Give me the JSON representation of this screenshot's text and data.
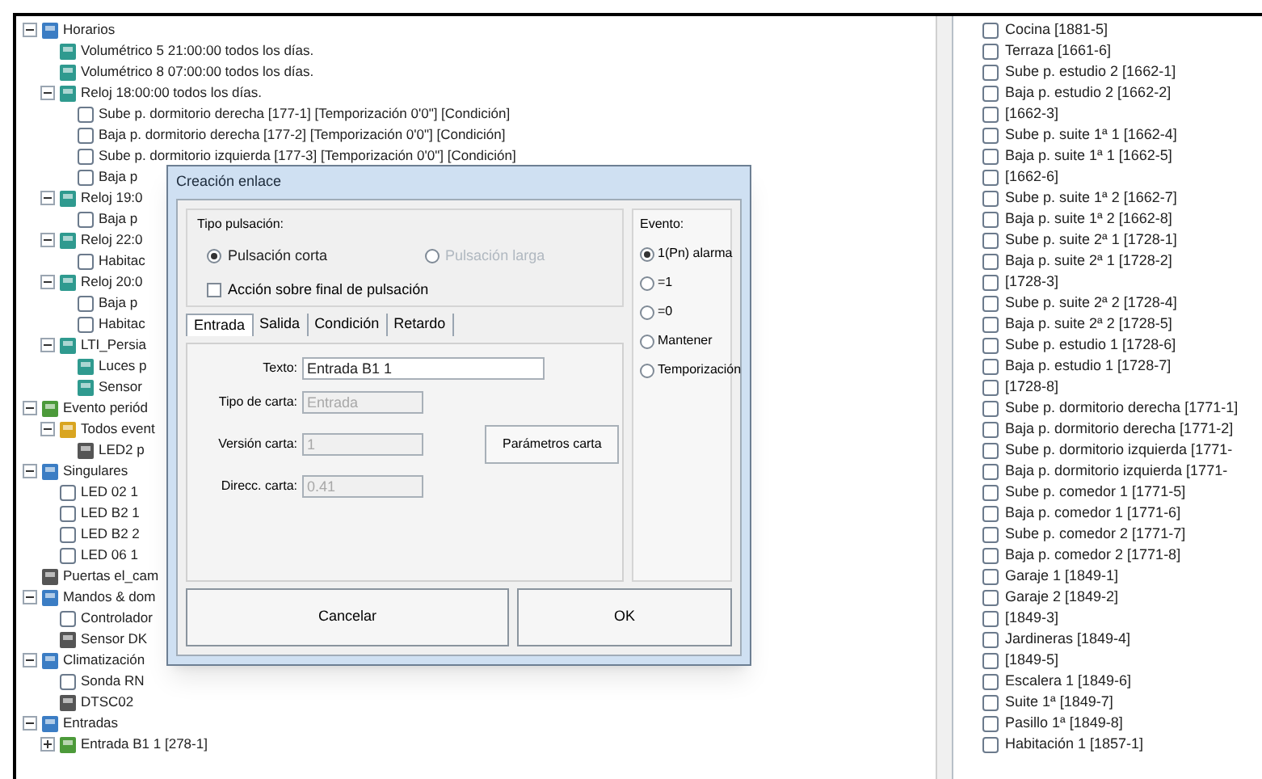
{
  "tree": [
    {
      "label": "Horarios",
      "kind": "group",
      "expanded": true,
      "children": [
        {
          "label": "Volumétrico 5 21:00:00 todos los días.",
          "kind": "schedule"
        },
        {
          "label": "Volumétrico 8 07:00:00 todos los días.",
          "kind": "schedule"
        },
        {
          "label": "Reloj 18:00:00 todos los días.",
          "kind": "schedule",
          "expanded": true,
          "children": [
            {
              "label": "Sube p. dormitorio derecha [177-1] [Temporización 0'0\"] [Condición]",
              "kind": "action"
            },
            {
              "label": "Baja p. dormitorio derecha [177-2] [Temporización 0'0\"] [Condición]",
              "kind": "action"
            },
            {
              "label": "Sube p. dormitorio izquierda [177-3] [Temporización 0'0\"] [Condición]",
              "kind": "action"
            },
            {
              "label": "Baja p",
              "kind": "action"
            }
          ]
        },
        {
          "label": "Reloj 19:0",
          "kind": "schedule",
          "expanded": true,
          "children": [
            {
              "label": "Baja p",
              "kind": "action"
            }
          ]
        },
        {
          "label": "Reloj 22:0",
          "kind": "schedule",
          "expanded": true,
          "children": [
            {
              "label": "Habitac",
              "kind": "action"
            }
          ]
        },
        {
          "label": "Reloj 20:0",
          "kind": "schedule",
          "expanded": true,
          "children": [
            {
              "label": "Baja p",
              "kind": "action"
            },
            {
              "label": "Habitac",
              "kind": "action"
            }
          ]
        },
        {
          "label": "LTI_Persia",
          "kind": "schedule",
          "expanded": true,
          "children": [
            {
              "label": "Luces p",
              "kind": "schedule"
            },
            {
              "label": "Sensor",
              "kind": "schedule"
            }
          ]
        }
      ]
    },
    {
      "label": "Evento periód",
      "kind": "event",
      "expanded": true,
      "children": [
        {
          "label": "Todos event",
          "kind": "alarm",
          "expanded": true,
          "children": [
            {
              "label": "LED2 p",
              "kind": "device"
            }
          ]
        }
      ]
    },
    {
      "label": "Singulares",
      "kind": "group",
      "expanded": true,
      "children": [
        {
          "label": "LED 02 1",
          "kind": "action"
        },
        {
          "label": "LED B2 1",
          "kind": "action"
        },
        {
          "label": "LED B2 2",
          "kind": "action"
        },
        {
          "label": "LED 06 1",
          "kind": "action"
        }
      ]
    },
    {
      "label": "Puertas el_cam",
      "kind": "device"
    },
    {
      "label": "Mandos & dom",
      "kind": "group",
      "expanded": true,
      "children": [
        {
          "label": "Controlador",
          "kind": "action"
        },
        {
          "label": "Sensor DK",
          "kind": "device"
        }
      ]
    },
    {
      "label": "Climatización",
      "kind": "group",
      "expanded": true,
      "children": [
        {
          "label": "Sonda RN",
          "kind": "action"
        },
        {
          "label": "DTSC02",
          "kind": "device"
        }
      ]
    },
    {
      "label": "Entradas",
      "kind": "group",
      "expanded": true,
      "children": [
        {
          "label": "Entrada B1 1 [278-1]",
          "kind": "event",
          "expanded": false
        }
      ]
    }
  ],
  "dialog": {
    "title": "Creación enlace",
    "press_group": {
      "title": "Tipo pulsación:",
      "options": [
        {
          "label": "Pulsación corta",
          "selected": true,
          "disabled": false
        },
        {
          "label": "Pulsación larga",
          "selected": false,
          "disabled": true
        }
      ],
      "end_action": {
        "label": "Acción sobre final de pulsación",
        "checked": false
      }
    },
    "tabs": [
      {
        "label": "Entrada",
        "selected": true
      },
      {
        "label": "Salida",
        "selected": false
      },
      {
        "label": "Condición",
        "selected": false
      },
      {
        "label": "Retardo",
        "selected": false
      }
    ],
    "fields": [
      {
        "label": "Texto:",
        "value": "Entrada B1 1",
        "disabled": false,
        "wide": true
      },
      {
        "label": "Tipo de carta:",
        "value": "Entrada",
        "disabled": true,
        "wide": false
      },
      {
        "label": "Versión carta:",
        "value": "1",
        "disabled": true,
        "wide": false
      },
      {
        "label": "Direcc. carta:",
        "value": "0.41",
        "disabled": true,
        "wide": false
      }
    ],
    "card_button": "Parámetros carta",
    "event_group": {
      "title": "Evento:",
      "options": [
        {
          "label": "1(Pn) alarma",
          "selected": true
        },
        {
          "label": "=1",
          "selected": false
        },
        {
          "label": "=0",
          "selected": false
        },
        {
          "label": "Mantener",
          "selected": false
        },
        {
          "label": "Temporización",
          "selected": false
        }
      ]
    },
    "buttons": [
      "Cancelar",
      "OK"
    ]
  },
  "list": [
    "Cocina [1881-5]",
    "Terraza [1661-6]",
    "Sube p. estudio 2 [1662-1]",
    "Baja p. estudio 2 [1662-2]",
    "[1662-3]",
    "Sube p. suite 1ª 1 [1662-4]",
    "Baja p. suite 1ª 1 [1662-5]",
    "[1662-6]",
    "Sube p. suite 1ª 2 [1662-7]",
    "Baja p. suite 1ª 2 [1662-8]",
    "Sube p. suite 2ª 1 [1728-1]",
    "Baja p. suite 2ª 1 [1728-2]",
    "[1728-3]",
    "Sube p. suite 2ª 2 [1728-4]",
    "Baja p. suite 2ª 2 [1728-5]",
    "Sube p. estudio 1 [1728-6]",
    "Baja p. estudio 1 [1728-7]",
    "[1728-8]",
    "Sube p. dormitorio derecha [1771-1]",
    "Baja p. dormitorio derecha [1771-2]",
    "Sube p. dormitorio izquierda [1771-",
    "Baja p. dormitorio izquierda [1771-",
    "Sube p. comedor 1 [1771-5]",
    "Baja p. comedor 1 [1771-6]",
    "Sube p. comedor 2 [1771-7]",
    "Baja p. comedor 2 [1771-8]",
    "Garaje 1 [1849-1]",
    "Garaje 2 [1849-2]",
    "[1849-3]",
    "Jardineras [1849-4]",
    "[1849-5]",
    "Escalera 1 [1849-6]",
    "Suite 1ª [1849-7]",
    "Pasillo 1ª [1849-8]",
    "Habitación 1 [1857-1]"
  ]
}
